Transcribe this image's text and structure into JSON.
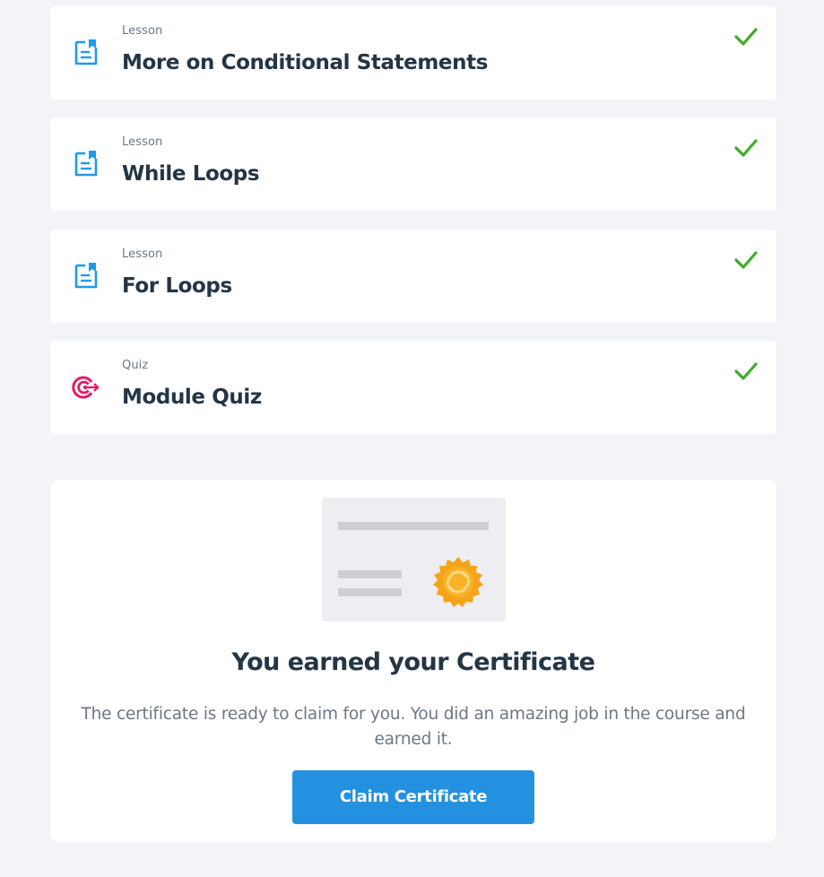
{
  "modules": [
    {
      "type": "Lesson",
      "title": "More on Conditional Statements",
      "icon": "lesson-icon",
      "completed": true
    },
    {
      "type": "Lesson",
      "title": "While Loops",
      "icon": "lesson-icon",
      "completed": true
    },
    {
      "type": "Lesson",
      "title": "For Loops",
      "icon": "lesson-icon",
      "completed": true
    },
    {
      "type": "Quiz",
      "title": "Module Quiz",
      "icon": "quiz-target-icon",
      "completed": true
    }
  ],
  "certificate": {
    "heading": "You earned your Certificate",
    "description": "The certificate is ready to claim for you. You did an amazing job in the course and earned it.",
    "button_label": "Claim Certificate"
  },
  "colors": {
    "background": "#f2f4f7",
    "lesson_icon": "#1e9be8",
    "quiz_icon": "#e01e63",
    "check": "#3eac25",
    "button": "#2491e0",
    "seal": "#f5a41a"
  }
}
